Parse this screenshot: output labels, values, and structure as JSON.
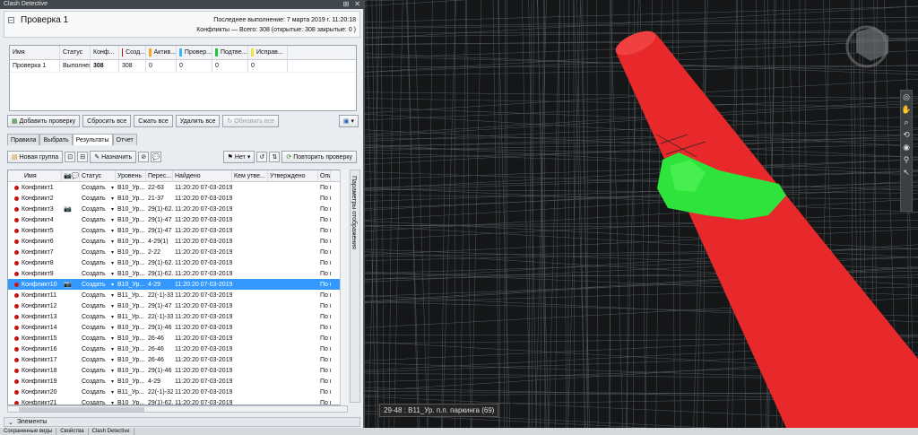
{
  "window": {
    "title": "Clash Detective",
    "pin": "⊞",
    "close": "✕"
  },
  "header": {
    "expander": "–",
    "test_name": "Проверка 1",
    "last_run": "Последнее выполнение:  7 марта 2019 г. 11:20:18",
    "conflicts": "Конфликты — Всего: 308  (открытые: 308  закрытые: 0 )"
  },
  "tests_table": {
    "columns": [
      {
        "label": "Имя",
        "swatch": ""
      },
      {
        "label": "Статус",
        "swatch": ""
      },
      {
        "label": "Конф...",
        "swatch": ""
      },
      {
        "label": "Созд...",
        "swatch": "#d0021b"
      },
      {
        "label": "Актив...",
        "swatch": "#f5a623"
      },
      {
        "label": "Провер...",
        "swatch": "#38b6f5"
      },
      {
        "label": "Подтве...",
        "swatch": "#21c43a"
      },
      {
        "label": "Исправ...",
        "swatch": "#f5e13a"
      }
    ],
    "rows": [
      [
        "Проверка 1",
        "Выполнен",
        "308",
        "308",
        "0",
        "0",
        "0",
        "0"
      ]
    ]
  },
  "test_buttons": {
    "add": "Добавить проверку",
    "reset_all": "Сбросить все",
    "compact_all": "Сжать все",
    "delete_all": "Удалить все",
    "refresh_all": "Обновить все"
  },
  "tabs": [
    {
      "label": "Правила"
    },
    {
      "label": "Выбрать"
    },
    {
      "label": "Результаты"
    },
    {
      "label": "Отчет"
    }
  ],
  "results_toolbar": {
    "new_group": "Новая группа",
    "assign": "Назначить",
    "filter": "Нет",
    "rerun": "Повторить проверку"
  },
  "results": {
    "columns": [
      "Имя",
      "",
      "Статус",
      "Уровень",
      "Перес...",
      "Найдено",
      "Кем утве...",
      "Утверждено",
      "Опи"
    ],
    "rows": [
      {
        "name": "Конфликт1",
        "cam": "",
        "status": "Создать",
        "level": "B10_Ур...",
        "grid": "22-63",
        "found": "11:20:20 07-03-2019",
        "desc": "По п"
      },
      {
        "name": "Конфликт2",
        "cam": "",
        "status": "Создать",
        "level": "B10_Ур...",
        "grid": "21-37",
        "found": "11:20:20 07-03-2019",
        "desc": "По п"
      },
      {
        "name": "Конфликт3",
        "cam": "📷",
        "status": "Создать",
        "level": "B10_Ур...",
        "grid": "29(1)-62...",
        "found": "11:20:20 07-03-2019",
        "desc": "По п"
      },
      {
        "name": "Конфликт4",
        "cam": "",
        "status": "Создать",
        "level": "B10_Ур...",
        "grid": "29(1)-47",
        "found": "11:20:20 07-03-2019",
        "desc": "По п"
      },
      {
        "name": "Конфликт5",
        "cam": "",
        "status": "Создать",
        "level": "B10_Ур...",
        "grid": "29(1)-47",
        "found": "11:20:20 07-03-2019",
        "desc": "По п"
      },
      {
        "name": "Конфликт6",
        "cam": "",
        "status": "Создать",
        "level": "B10_Ур...",
        "grid": "4-29(1)",
        "found": "11:20:20 07-03-2019",
        "desc": "По п"
      },
      {
        "name": "Конфликт7",
        "cam": "",
        "status": "Создать",
        "level": "B10_Ур...",
        "grid": "2-22",
        "found": "11:20:20 07-03-2019",
        "desc": "По п"
      },
      {
        "name": "Конфликт8",
        "cam": "",
        "status": "Создать",
        "level": "B10_Ур...",
        "grid": "29(1)-62...",
        "found": "11:20:20 07-03-2019",
        "desc": "По п"
      },
      {
        "name": "Конфликт9",
        "cam": "",
        "status": "Создать",
        "level": "B10_Ур...",
        "grid": "29(1)-62...",
        "found": "11:20:20 07-03-2019",
        "desc": "По п"
      },
      {
        "name": "Конфликт10",
        "cam": "📷",
        "status": "Создать",
        "level": "B10_Ур...",
        "grid": "4-29",
        "found": "11:20:20 07-03-2019",
        "desc": "По п"
      },
      {
        "name": "Конфликт11",
        "cam": "",
        "status": "Создать",
        "level": "B11_Ур...",
        "grid": "22(-1)-33",
        "found": "11:20:20 07-03-2019",
        "desc": "По п"
      },
      {
        "name": "Конфликт12",
        "cam": "",
        "status": "Создать",
        "level": "B10_Ур...",
        "grid": "29(1)-47",
        "found": "11:20:20 07-03-2019",
        "desc": "По п"
      },
      {
        "name": "Конфликт13",
        "cam": "",
        "status": "Создать",
        "level": "B11_Ур...",
        "grid": "22(-1)-33",
        "found": "11:20:20 07-03-2019",
        "desc": "По п"
      },
      {
        "name": "Конфликт14",
        "cam": "",
        "status": "Создать",
        "level": "B10_Ур...",
        "grid": "29(1)-46",
        "found": "11:20:20 07-03-2019",
        "desc": "По п"
      },
      {
        "name": "Конфликт15",
        "cam": "",
        "status": "Создать",
        "level": "B10_Ур...",
        "grid": "26-46",
        "found": "11:20:20 07-03-2019",
        "desc": "По п"
      },
      {
        "name": "Конфликт16",
        "cam": "",
        "status": "Создать",
        "level": "B10_Ур...",
        "grid": "26-46",
        "found": "11:20:20 07-03-2019",
        "desc": "По п"
      },
      {
        "name": "Конфликт17",
        "cam": "",
        "status": "Создать",
        "level": "B10_Ур...",
        "grid": "26-46",
        "found": "11:20:20 07-03-2019",
        "desc": "По п"
      },
      {
        "name": "Конфликт18",
        "cam": "",
        "status": "Создать",
        "level": "B10_Ур...",
        "grid": "29(1)-46",
        "found": "11:20:20 07-03-2019",
        "desc": "По п"
      },
      {
        "name": "Конфликт19",
        "cam": "",
        "status": "Создать",
        "level": "B10_Ур...",
        "grid": "4-29",
        "found": "11:20:20 07-03-2019",
        "desc": "По п"
      },
      {
        "name": "Конфликт20",
        "cam": "",
        "status": "Создать",
        "level": "B11_Ур...",
        "grid": "22(-1)-32",
        "found": "11:20:20 07-03-2019",
        "desc": "По п"
      },
      {
        "name": "Конфликт21",
        "cam": "",
        "status": "Создать",
        "level": "B10_Ур...",
        "grid": "29(1)-62...",
        "found": "11:20:20 07-03-2019",
        "desc": "По п"
      }
    ],
    "selected_index": 9
  },
  "side_panel": {
    "label": "Параметры отображения"
  },
  "elements_panel": {
    "expander": "⌄",
    "label": "Элементы"
  },
  "bottom_tabs": [
    {
      "label": "Сохраненные виды"
    },
    {
      "label": "Свойства"
    },
    {
      "label": "Clash Detective"
    }
  ],
  "viewport": {
    "status": "29-48 : B11_Ур. п.п. паркинга (69)"
  },
  "colors": {
    "pipe": "#e8292b",
    "highlight": "#2ee33a",
    "selection": "#3399ff",
    "status_dot": "#cc1111"
  }
}
